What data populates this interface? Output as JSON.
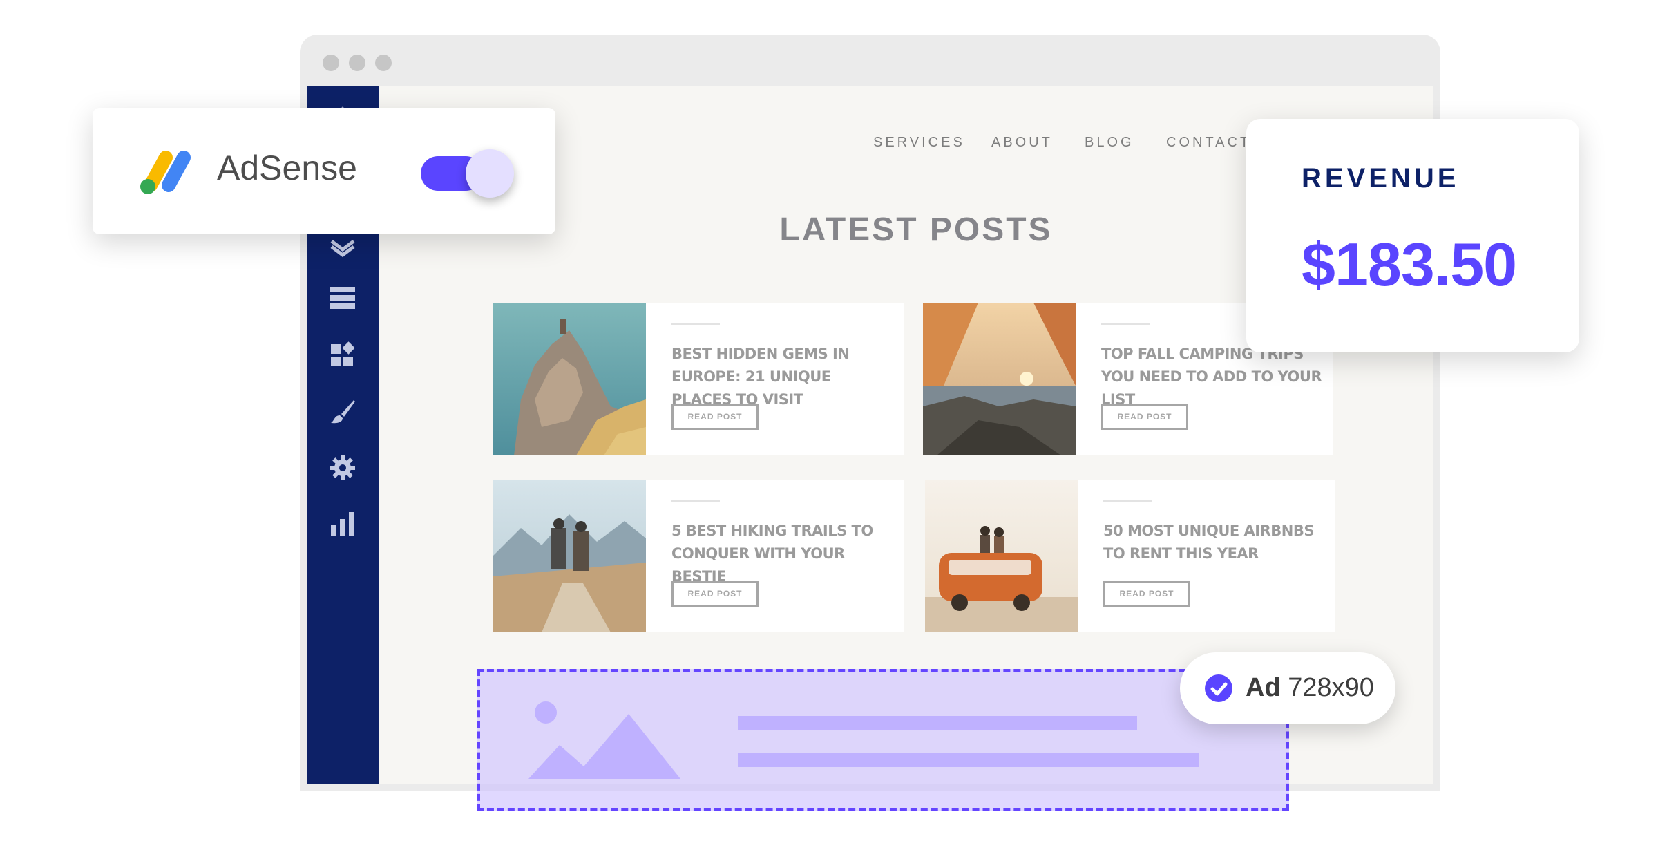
{
  "nav": {
    "items": [
      "SERVICES",
      "ABOUT",
      "BLOG",
      "CONTACT"
    ]
  },
  "main": {
    "title": "LATEST POSTS",
    "posts": [
      {
        "title": "Best Hidden Gems in Europe: 21 Unique Places to Visit",
        "button": "READ POST"
      },
      {
        "title": "Top Fall Camping Trips You Need to Add to Your List",
        "button": "READ POST"
      },
      {
        "title": "5 Best Hiking Trails to Conquer with Your Bestie",
        "button": "READ POST"
      },
      {
        "title": "50 Most Unique Airbnbs to Rent This Year",
        "button": "READ POST"
      }
    ]
  },
  "adsense": {
    "label": "AdSense",
    "enabled": true
  },
  "revenue": {
    "label": "REVENUE",
    "value": "$183.50"
  },
  "ad_badge": {
    "prefix": "Ad",
    "size": "728x90"
  },
  "sidebar": {
    "icons": [
      "layers-icon",
      "list-icon",
      "widgets-icon",
      "brush-icon",
      "gear-icon",
      "bar-chart-icon"
    ]
  },
  "colors": {
    "sidebar": "#0d2167",
    "accent": "#5a45ff",
    "ad_zone": "#cdc0ff"
  }
}
